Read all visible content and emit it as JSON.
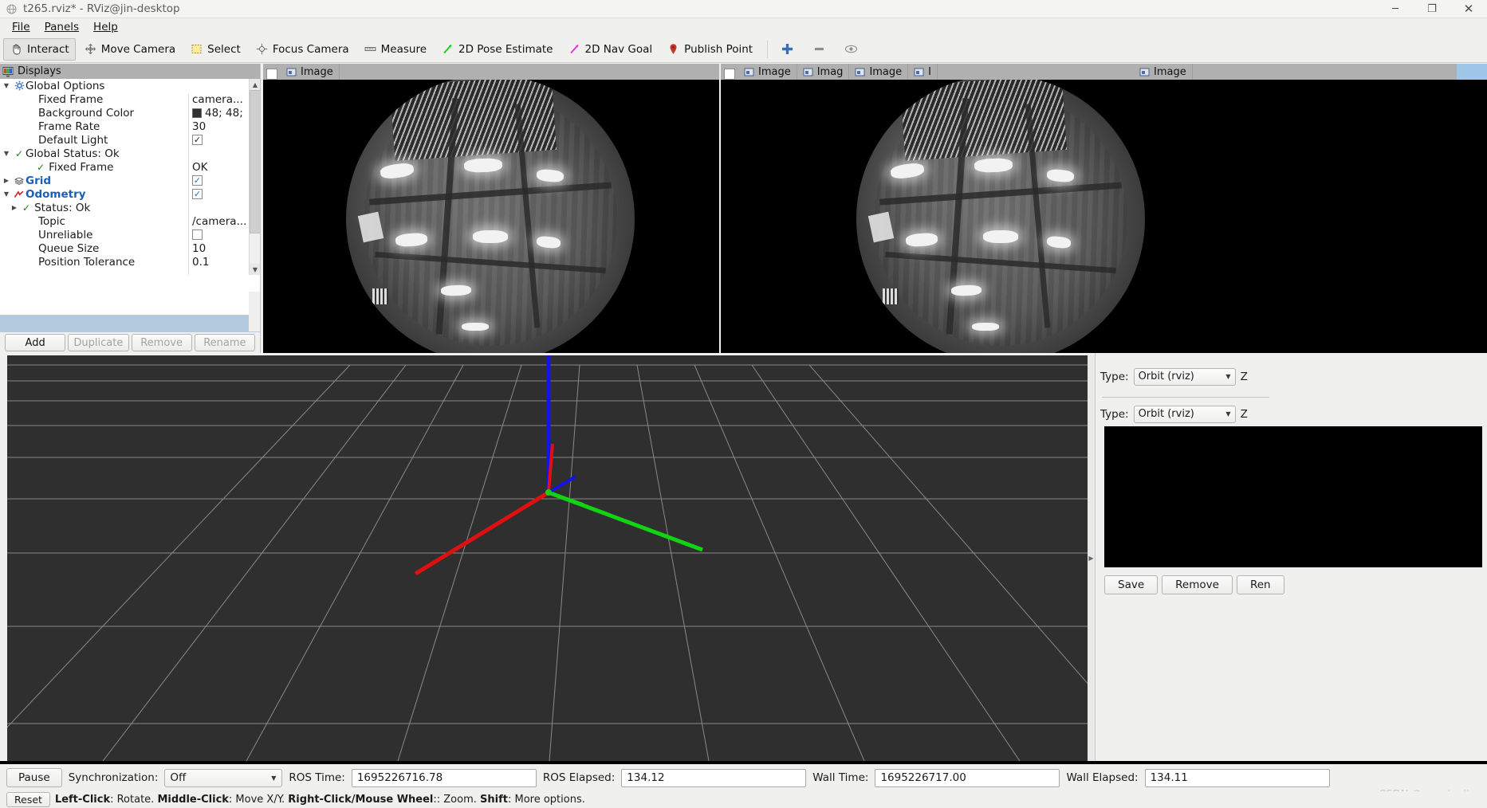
{
  "window": {
    "title": "t265.rviz* - RViz@jin-desktop",
    "app_icon": "rviz-icon",
    "minimize": "─",
    "maximize": "❐",
    "close": "✕"
  },
  "menubar": {
    "items": [
      {
        "label": "File",
        "mnemonic": "F"
      },
      {
        "label": "Panels",
        "mnemonic": "P"
      },
      {
        "label": "Help",
        "mnemonic": "H"
      }
    ]
  },
  "toolbar": {
    "tools": [
      {
        "label": "Interact",
        "icon": "hand-cursor-icon",
        "active": true
      },
      {
        "label": "Move Camera",
        "icon": "move-camera-icon",
        "active": false
      },
      {
        "label": "Select",
        "icon": "select-rect-icon",
        "active": false
      },
      {
        "label": "Focus Camera",
        "icon": "focus-camera-icon",
        "active": false
      },
      {
        "label": "Measure",
        "icon": "measure-ruler-icon",
        "active": false
      },
      {
        "label": "2D Pose Estimate",
        "icon": "pose-estimate-arrow-icon",
        "active": false
      },
      {
        "label": "2D Nav Goal",
        "icon": "nav-goal-arrow-icon",
        "active": false
      },
      {
        "label": "Publish Point",
        "icon": "map-pin-icon",
        "active": false
      }
    ],
    "extra_icons": [
      {
        "name": "add-tool-icon",
        "glyph": "✚"
      },
      {
        "name": "remove-tool-icon",
        "glyph": "━"
      },
      {
        "name": "tool-properties-icon",
        "glyph": "◉"
      }
    ]
  },
  "displays_panel": {
    "header": "Displays",
    "header_icon": "displays-panel-icon",
    "tree": [
      {
        "indent": 0,
        "arrow": "down",
        "icon": "gear-icon",
        "label": "Global Options",
        "bold": true,
        "value_type": "none",
        "value": ""
      },
      {
        "indent": 1,
        "arrow": "none",
        "icon": "none",
        "label": "Fixed Frame",
        "bold": false,
        "value_type": "text",
        "value": "camera..."
      },
      {
        "indent": 1,
        "arrow": "none",
        "icon": "none",
        "label": "Background Color",
        "bold": false,
        "value_type": "color",
        "value": "48; 48;",
        "color": "#303030"
      },
      {
        "indent": 1,
        "arrow": "none",
        "icon": "none",
        "label": "Frame Rate",
        "bold": false,
        "value_type": "text",
        "value": "30"
      },
      {
        "indent": 1,
        "arrow": "none",
        "icon": "none",
        "label": "Default Light",
        "bold": false,
        "value_type": "check-dark",
        "value": "✓"
      },
      {
        "indent": 0,
        "arrow": "down",
        "icon": "check-green-icon",
        "label": "Global Status: Ok",
        "bold": false,
        "value_type": "none",
        "value": ""
      },
      {
        "indent": 1,
        "arrow": "none",
        "icon": "check-green-icon",
        "label": "Fixed Frame",
        "bold": false,
        "value_type": "text",
        "value": "OK"
      },
      {
        "indent": 0,
        "arrow": "right",
        "icon": "grid-icon",
        "label": "Grid",
        "bold": true,
        "value_type": "check-blue",
        "value": "✓"
      },
      {
        "indent": 0,
        "arrow": "down",
        "icon": "odometry-icon",
        "label": "Odometry",
        "bold": true,
        "value_type": "check-blue",
        "value": "✓"
      },
      {
        "indent": 1,
        "arrow": "right",
        "icon": "check-green-icon",
        "label": "Status: Ok",
        "bold": false,
        "value_type": "none",
        "value": ""
      },
      {
        "indent": 1,
        "arrow": "none",
        "icon": "none",
        "label": "Topic",
        "bold": false,
        "value_type": "text",
        "value": "/camera..."
      },
      {
        "indent": 1,
        "arrow": "none",
        "icon": "none",
        "label": "Unreliable",
        "bold": false,
        "value_type": "check-empty",
        "value": ""
      },
      {
        "indent": 1,
        "arrow": "none",
        "icon": "none",
        "label": "Queue Size",
        "bold": false,
        "value_type": "text",
        "value": "10"
      },
      {
        "indent": 1,
        "arrow": "none",
        "icon": "none",
        "label": "Position Tolerance",
        "bold": false,
        "value_type": "text",
        "value": "0.1"
      }
    ],
    "buttons": [
      {
        "label": "Add",
        "enabled": true
      },
      {
        "label": "Duplicate",
        "enabled": false
      },
      {
        "label": "Remove",
        "enabled": false
      },
      {
        "label": "Rename",
        "enabled": false
      }
    ]
  },
  "image_docks": {
    "left": {
      "tab_label": "Image",
      "tab_icon": "image-display-icon"
    },
    "right_tabs": [
      {
        "label": "Image",
        "icon": "image-display-icon"
      },
      {
        "label": "Imag",
        "icon": "image-display-icon"
      },
      {
        "label": "Image",
        "icon": "image-display-icon"
      },
      {
        "label": "I",
        "icon": "image-display-icon"
      },
      {
        "label": "Image",
        "icon": "image-display-icon"
      }
    ]
  },
  "views_panel": {
    "rows": [
      {
        "label": "Type:",
        "value": "Orbit (rviz)",
        "trailing": "Z"
      },
      {
        "label": "Type:",
        "value": "Orbit (rviz)",
        "trailing": "Z"
      }
    ],
    "buttons": [
      {
        "label": "Save"
      },
      {
        "label": "Remove"
      },
      {
        "label": "Ren"
      }
    ]
  },
  "timebar": {
    "pause_label": "Pause",
    "sync_label": "Synchronization:",
    "sync_value": "Off",
    "ros_time_label": "ROS Time:",
    "ros_time_value": "1695226716.78",
    "ros_elapsed_label": "ROS Elapsed:",
    "ros_elapsed_value": "134.12",
    "wall_time_label": "Wall Time:",
    "wall_time_value": "1695226717.00",
    "wall_elapsed_label": "Wall Elapsed:",
    "wall_elapsed_value": "134.11"
  },
  "watermark": "CSDN @yangtsejin",
  "statusbar": {
    "reset_label": "Reset",
    "hint_parts": [
      {
        "text": "Left-Click",
        "bold": true
      },
      {
        "text": ": Rotate.  ",
        "bold": false
      },
      {
        "text": "Middle-Click",
        "bold": true
      },
      {
        "text": ": Move X/Y.  ",
        "bold": false
      },
      {
        "text": "Right-Click/Mouse Wheel",
        "bold": true
      },
      {
        "text": ":: Zoom.  ",
        "bold": false
      },
      {
        "text": "Shift",
        "bold": true
      },
      {
        "text": ": More options.",
        "bold": false
      }
    ]
  },
  "colors": {
    "axis_x": "#e01010",
    "axis_y": "#13d413",
    "axis_z": "#1414e6",
    "view_bg": "#2f2f2f",
    "grid_line": "#9a9a9a",
    "panel_header": "#b0b0b0",
    "selection": "#b4cbdf"
  }
}
